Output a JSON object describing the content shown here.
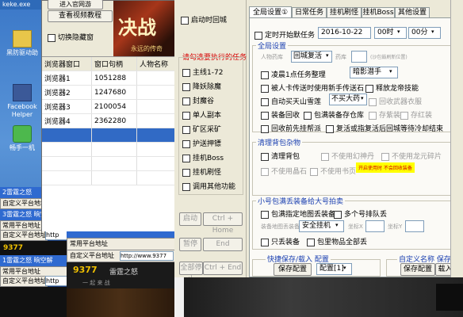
{
  "desktop": {
    "top_text": "keke.exe",
    "icons": [
      {
        "label": "黑防驱动助"
      },
      {
        "label": "Facebook Helper"
      },
      {
        "label": "畅手一机"
      }
    ],
    "taskbar_items": [
      "2雷霆之怒",
      "自定义平台地址",
      "3雷霆之怒 晌空解",
      "常用平台地址",
      "自定义平台地址",
      "1雷霆之怒 晌空解",
      "常用平台地址",
      "自定义平台地址"
    ],
    "url_fragment_1": "http",
    "url_fragment_2": "http",
    "url_fragment_3": "http://www.9377",
    "banner_brand_1": "9377",
    "banner_brand_2": "9377",
    "banner_game_1": "雷霆之怒",
    "banner_game_2": "雷霆之怒",
    "banner_sub_1": "一 起 来 战",
    "banner_sub_2": "一 起 来 战",
    "address_label": "自定义平台地址",
    "address_value": "http://www.9377",
    "common_label": "常用平台地址"
  },
  "left_panel": {
    "top_button": "进入官网游",
    "tutorial_button": "查看视频教程",
    "hide_window_label": "切换隐藏窗",
    "game_logo": "决战",
    "game_logo_sub": "永远的传奇",
    "table_headers": [
      "浏览器窗口",
      "窗口句柄",
      "人物名称"
    ],
    "rows": [
      {
        "window": "浏览器1",
        "handle": "1051288",
        "name": ""
      },
      {
        "window": "浏览器2",
        "handle": "1247680",
        "name": ""
      },
      {
        "window": "浏览器3",
        "handle": "2100054",
        "name": ""
      },
      {
        "window": "浏览器4",
        "handle": "2362280",
        "name": ""
      }
    ]
  },
  "task_panel": {
    "startup_label": "启动时回城",
    "prompt": "请勾选要执行的任务",
    "tasks": [
      "主线1-72",
      "降妖除魔",
      "封魔谷",
      "单人副本",
      "矿区采矿",
      "护送押镖",
      "挂机Boss",
      "挂机刷怪",
      "调用其他功能"
    ],
    "start_button": "启动",
    "start_hotkey": "Ctrl + Home",
    "pause_button": "暂停",
    "pause_hotkey": "End",
    "stop_all_button": "全部停止",
    "stop_all_hotkey": "Ctrl + End"
  },
  "settings": {
    "tabs": [
      "全局设置①",
      "日常任务",
      "挂机刷怪",
      "挂机Boss",
      "其他设置"
    ],
    "timer_label": "定时开始默任务",
    "date_value": "2016-10-22",
    "hour_value": "00时",
    "minute_value": "00分",
    "global_title": "全局设置",
    "char_status_label": "人物药库",
    "char_status_value": "回城复活",
    "hp_label": "药库",
    "hp_hint": "(沙包鼓刷新位置)",
    "daily_label": "凌晨1点任务整理",
    "daily_value": "暗影潜手",
    "transfer_label": "被人卡传送时使用新手传送石",
    "refine_label": "释放龙帝技能",
    "auto_buy_label": "自动买天山雪莲",
    "auto_buy_value": "不买大药",
    "auto_buy_extra": "回收武器衣服",
    "recycle_label": "装备回收",
    "package_label": "包满装备存仓库",
    "package_extra_1": "存紫装",
    "package_extra_2": "存红装",
    "return_label": "回收前先挂帮派",
    "return_label_2": "复活或指复活后回城等待冷却结束",
    "clean_title": "清理背包杂物",
    "clean_label": "清理背包",
    "clean_opt_1": "不使用幻神丹",
    "clean_opt_2": "不使用龙元碎片",
    "clean_opt_3": "不使用晶石",
    "clean_opt_4": "不使用书页",
    "clean_note": "开启使用时 不会回收装备",
    "small_title": "小号包满丢装备给大号拍卖",
    "small_label": "包满指定地图丢装备",
    "small_label_2": "多个号排队丢",
    "small_map_label": "装备地图丢装备",
    "small_map_value": "安全挂机",
    "small_x_label": "坐标X",
    "small_y_label": "坐标Y",
    "only_drop_label": "只丢装备",
    "drop_all_label": "包里物品全部丢",
    "quick_title": "快捷保存/载入 配置",
    "save_config": "保存配置",
    "config_value": "配置[1]",
    "custom_title": "自定义名称 保存/载入",
    "save_config_2": "保存配置",
    "load_config_2": "载入配置"
  }
}
